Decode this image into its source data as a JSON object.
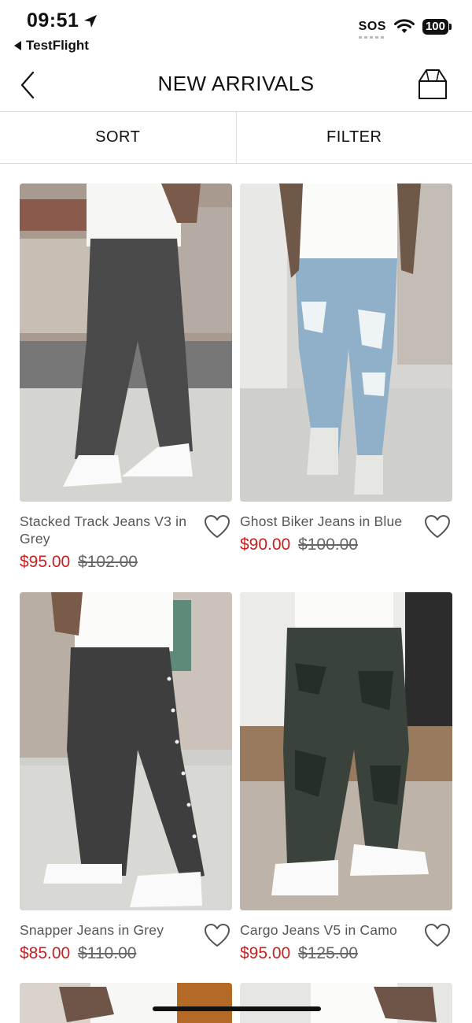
{
  "status_bar": {
    "time": "09:51",
    "back_app": "TestFlight",
    "sos": "SOS",
    "battery": "100"
  },
  "header": {
    "title": "NEW ARRIVALS"
  },
  "toolbar": {
    "sort_label": "SORT",
    "filter_label": "FILTER"
  },
  "products": [
    {
      "name": "Stacked Track Jeans V3 in Grey",
      "price": "$95.00",
      "was": "$102.00"
    },
    {
      "name": "Ghost Biker Jeans in Blue",
      "price": "$90.00",
      "was": "$100.00"
    },
    {
      "name": "Snapper Jeans in Grey",
      "price": "$85.00",
      "was": "$110.00"
    },
    {
      "name": "Cargo Jeans V5 in Camo",
      "price": "$95.00",
      "was": "$125.00"
    }
  ],
  "colors": {
    "price_red": "#c62020",
    "divider": "#dcdcdc"
  }
}
